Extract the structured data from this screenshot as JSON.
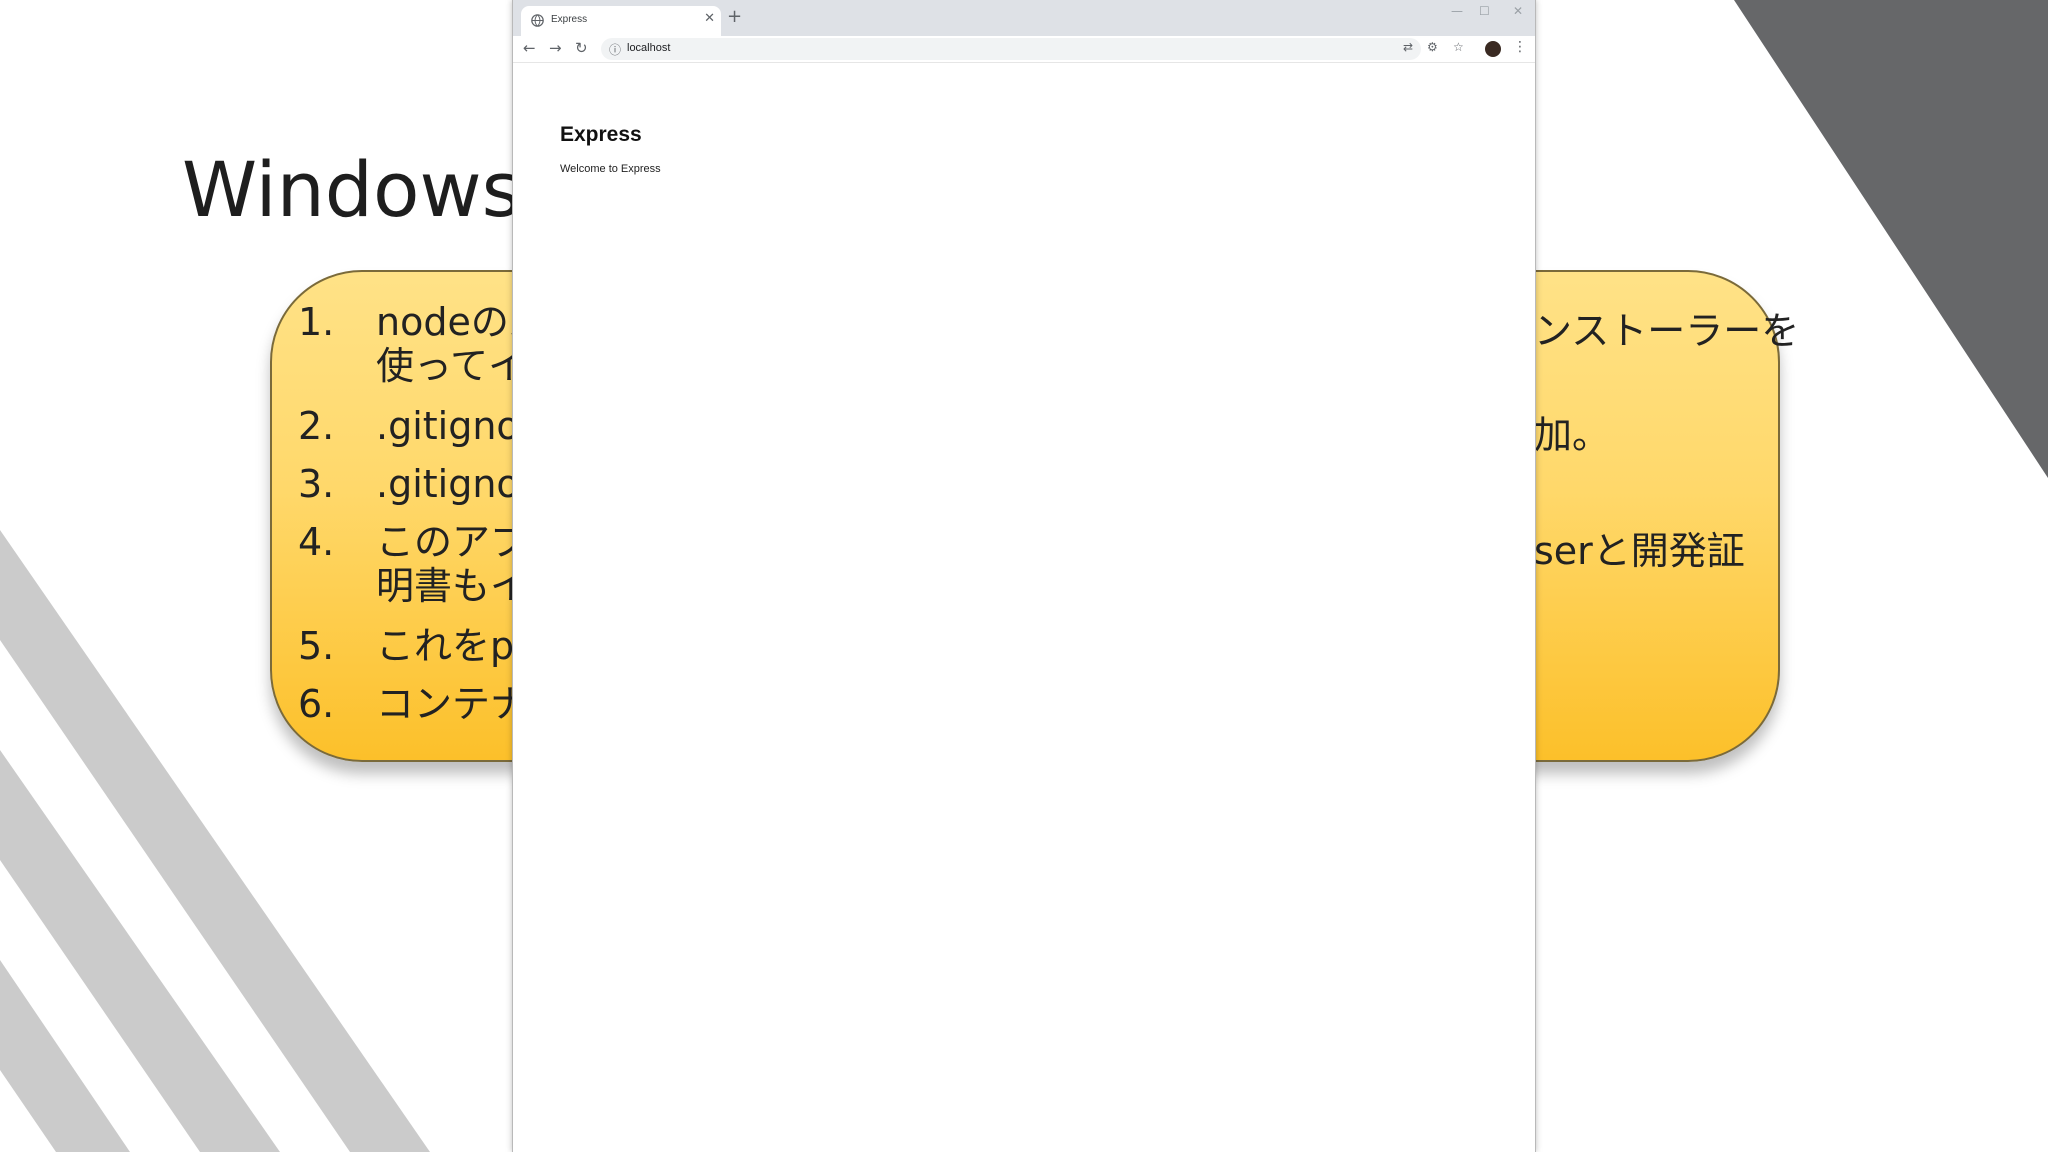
{
  "slide": {
    "title": "Windows向",
    "steps": [
      {
        "num": "1.",
        "line1": "nodeのバ",
        "line2": "使ってイン"
      },
      {
        "num": "2.",
        "line1": ".gitigno"
      },
      {
        "num": "3.",
        "line1": ".gitigno"
      },
      {
        "num": "4.",
        "line1": "このアプリ",
        "line2": "明書もイ"
      },
      {
        "num": "5.",
        "line1": "これをpu"
      },
      {
        "num": "6.",
        "line1": "コンテナの"
      }
    ],
    "right_fragments": {
      "step1": "ンストーラーを",
      "step2": "加。",
      "step4": "serと開発証"
    },
    "colors": {
      "callout_top": "#ffe287",
      "callout_bottom": "#fcc02a",
      "dark_stripe": "#666769",
      "light_stripe": "#cbcbcb"
    }
  },
  "browser": {
    "tab_title": "Express",
    "new_tab_glyph": "+",
    "close_glyph": "✕",
    "url": "localhost",
    "window_controls": {
      "minimize": "—",
      "maximize": "☐",
      "close": "✕"
    },
    "nav": {
      "back": "←",
      "forward": "→",
      "reload": "↻"
    },
    "icons": [
      "translate-icon",
      "extension-icon",
      "star-icon",
      "avatar",
      "menu-icon"
    ]
  },
  "page": {
    "heading": "Express",
    "paragraph": "Welcome to Express"
  }
}
